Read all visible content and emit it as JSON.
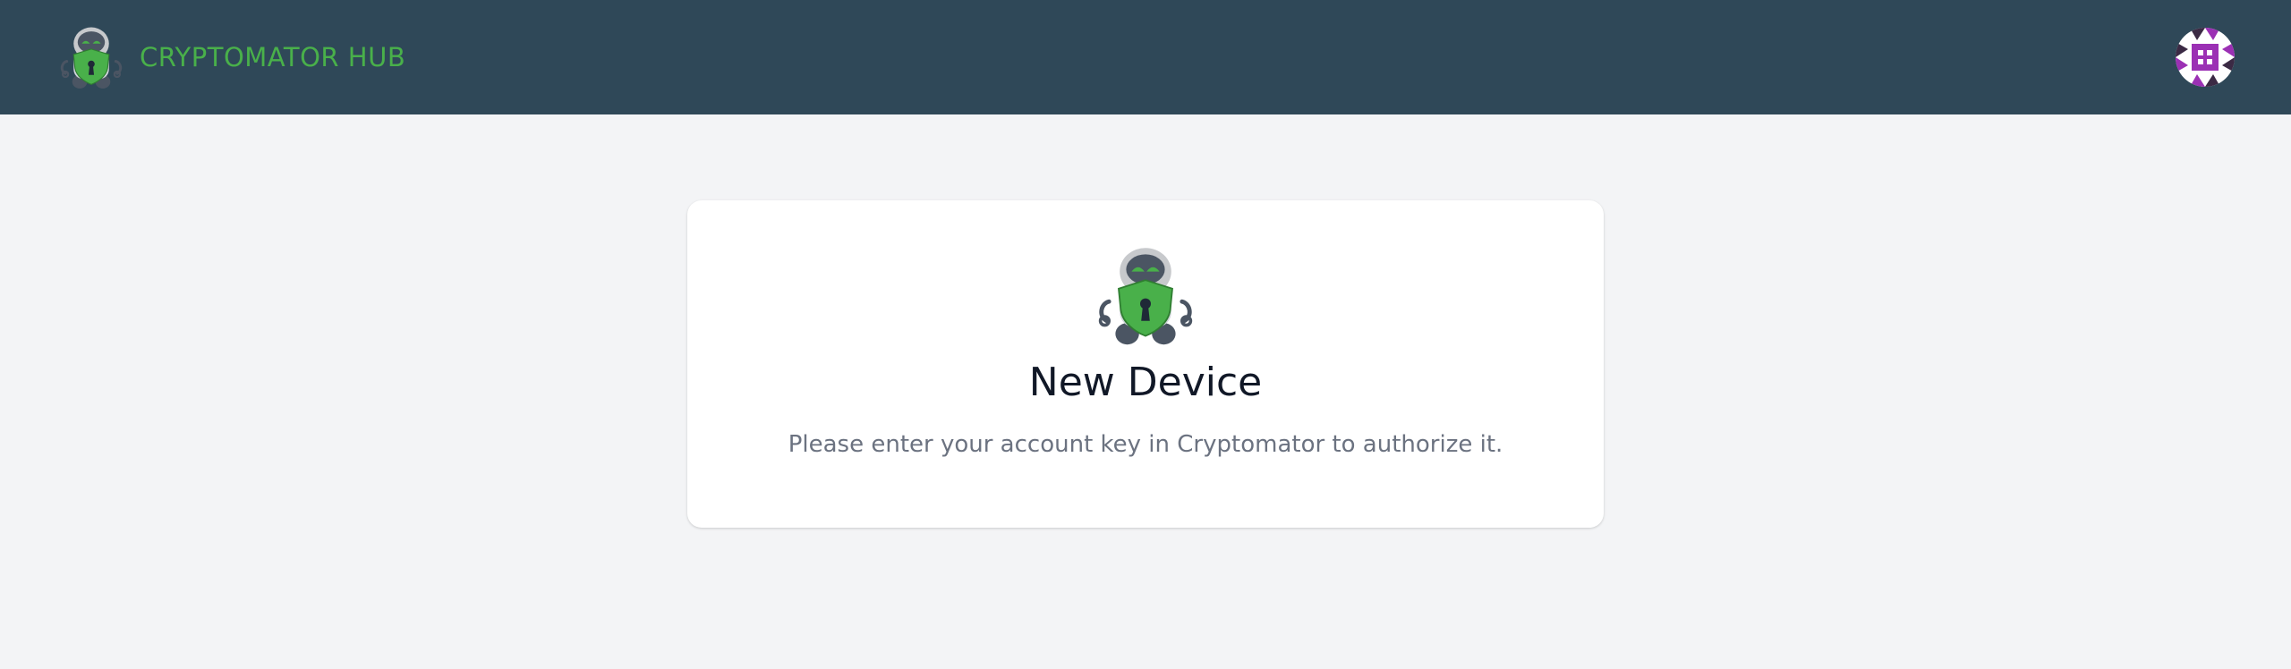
{
  "header": {
    "brand_name": "CRYPTOMATOR HUB",
    "logo_icon": "cryptomator-robot-icon",
    "avatar_icon": "user-identicon-avatar",
    "colors": {
      "bar": "#2f4858",
      "brand_text": "#49b04a"
    }
  },
  "main": {
    "card": {
      "icon": "cryptomator-robot-icon",
      "title": "New Device",
      "message": "Please enter your account key in Cryptomator to authorize it."
    }
  },
  "colors": {
    "background": "#f3f4f6",
    "card": "#ffffff",
    "title_text": "#111827",
    "message_text": "#6b7280",
    "robot_green": "#49b04a"
  }
}
